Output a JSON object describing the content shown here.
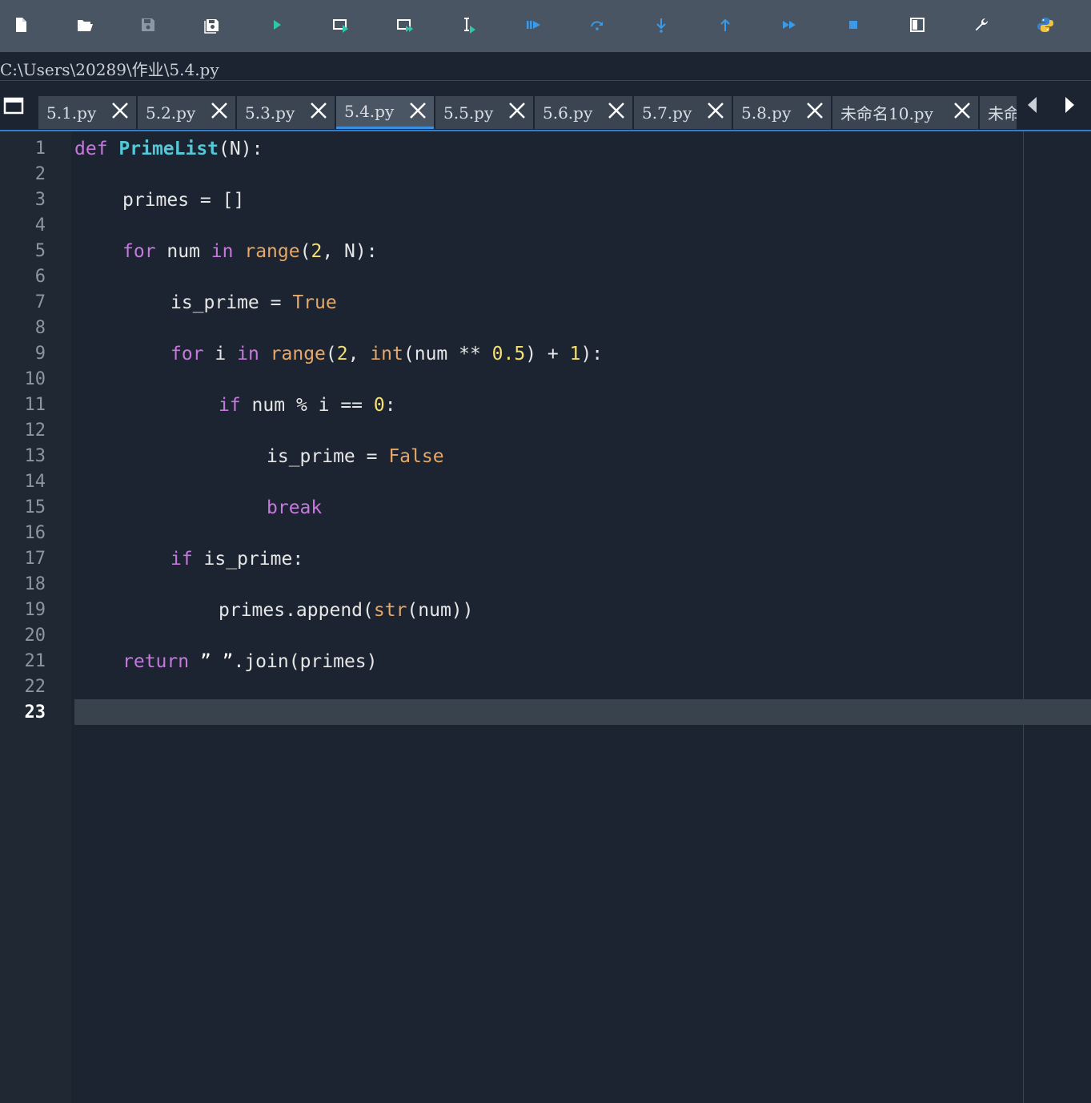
{
  "toolbar": {
    "buttons": [
      {
        "name": "new-file",
        "color": "#ffffff"
      },
      {
        "name": "open-file",
        "color": "#ffffff"
      },
      {
        "name": "save-file",
        "color": "#8e98a4"
      },
      {
        "name": "save-all",
        "color": "#ffffff"
      },
      {
        "name": "run",
        "color": "#2ec7a8"
      },
      {
        "name": "run-in-console",
        "color": "#ffffff"
      },
      {
        "name": "run-selection",
        "color": "#ffffff"
      },
      {
        "name": "run-to-cursor",
        "color": "#ffffff"
      },
      {
        "name": "debug",
        "color": "#3a9ae8"
      },
      {
        "name": "step-over",
        "color": "#3a9ae8"
      },
      {
        "name": "step-into",
        "color": "#3a9ae8"
      },
      {
        "name": "step-out",
        "color": "#3a9ae8"
      },
      {
        "name": "continue",
        "color": "#3a9ae8"
      },
      {
        "name": "stop",
        "color": "#3a9ae8"
      },
      {
        "name": "maximize-pane",
        "color": "#ffffff"
      },
      {
        "name": "preferences",
        "color": "#ffffff"
      },
      {
        "name": "python-path",
        "color": "#f0c43c"
      }
    ]
  },
  "path": "C:\\Users\\20289\\作业\\5.4.py",
  "tabs": [
    {
      "label": "5.1.py",
      "active": false
    },
    {
      "label": "5.2.py",
      "active": false
    },
    {
      "label": "5.3.py",
      "active": false
    },
    {
      "label": "5.4.py",
      "active": true
    },
    {
      "label": "5.5.py",
      "active": false
    },
    {
      "label": "5.6.py",
      "active": false
    },
    {
      "label": "5.7.py",
      "active": false
    },
    {
      "label": "5.8.py",
      "active": false
    },
    {
      "label": "未命名10.py",
      "active": false
    },
    {
      "label": "未命",
      "active": false
    }
  ],
  "editor": {
    "current_line": 23,
    "line_numbers": [
      "1",
      "2",
      "3",
      "4",
      "5",
      "6",
      "7",
      "8",
      "9",
      "10",
      "11",
      "12",
      "13",
      "14",
      "15",
      "16",
      "17",
      "18",
      "19",
      "20",
      "21",
      "22",
      "23"
    ],
    "code": {
      "l1": {
        "kw": "def",
        "fn": "PrimeList",
        "rest": "(N):"
      },
      "l3": {
        "text": "primes = []"
      },
      "l5": {
        "kw1": "for",
        "t1": " num ",
        "kw2": "in",
        "bi": "range",
        "t2": "(",
        "n1": "2",
        "t3": ", N):"
      },
      "l7": {
        "t1": "is_prime = ",
        "bi": "True"
      },
      "l9": {
        "kw1": "for",
        "t1": " i ",
        "kw2": "in",
        "bi1": "range",
        "t2": "(",
        "n1": "2",
        "t3": ", ",
        "bi2": "int",
        "t4": "(num ** ",
        "n2": "0.5",
        "t5": ") + ",
        "n3": "1",
        "t6": "):"
      },
      "l11": {
        "kw": "if",
        "t1": " num % i == ",
        "n1": "0",
        "t2": ":"
      },
      "l13": {
        "t1": "is_prime = ",
        "bi": "False"
      },
      "l15": {
        "kw": "break"
      },
      "l17": {
        "kw": "if",
        "t1": " is_prime:"
      },
      "l19": {
        "t1": "primes.append(",
        "bi": "str",
        "t2": "(num))"
      },
      "l21": {
        "kw": "return",
        "s1": " ” ”",
        "t1": ".join(primes)"
      }
    }
  }
}
